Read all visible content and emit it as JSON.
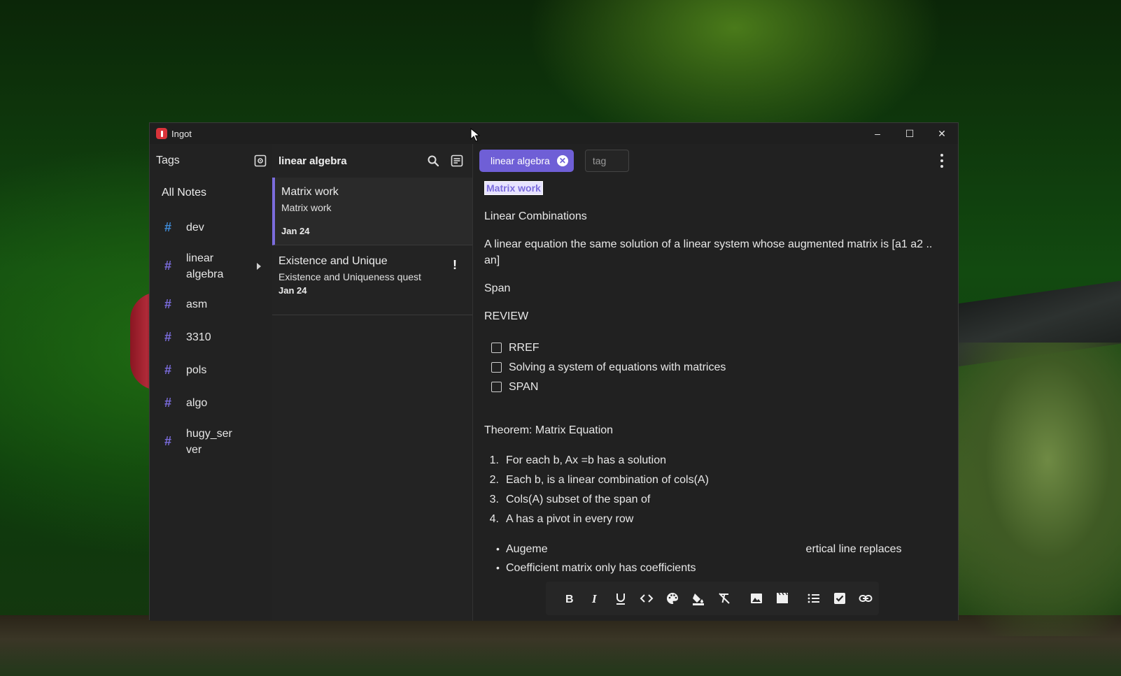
{
  "window": {
    "title": "Ingot",
    "controls": {
      "minimize": "–",
      "maximize": "☐",
      "close": "✕"
    }
  },
  "tags_panel": {
    "title": "Tags",
    "all_notes": "All Notes",
    "items": [
      {
        "label": "dev",
        "color": "#3f8bd8"
      },
      {
        "label": "linear algebra",
        "color": "#7b6cdc",
        "expandable": true
      },
      {
        "label": "asm",
        "color": "#7b6cdc"
      },
      {
        "label": "3310",
        "color": "#7b6cdc"
      },
      {
        "label": "pols",
        "color": "#7b6cdc"
      },
      {
        "label": "algo",
        "color": "#7b6cdc"
      },
      {
        "label": "hugy_server",
        "color": "#7b6cdc"
      }
    ]
  },
  "notes_panel": {
    "title": "linear algebra",
    "notes": [
      {
        "title": "Matrix work",
        "preview": "Matrix work",
        "date": "Jan 24",
        "active": true
      },
      {
        "title": "Existence and Unique",
        "preview": "Existence and Uniqueness quest",
        "date": "Jan 24",
        "flagged": true
      }
    ]
  },
  "editor": {
    "tag_chip": "linear algebra",
    "tag_input_placeholder": "tag",
    "heading": "Matrix work",
    "paragraphs": {
      "p1": "Linear Combinations",
      "p2": "A linear equation the same solution of a linear system whose augmented matrix is [a1 a2 .. an]",
      "p3": "Span",
      "p4": "REVIEW",
      "p5": "Theorem: Matrix Equation"
    },
    "checklist": [
      {
        "label": "RREF",
        "checked": false
      },
      {
        "label": "Solving a system of equations with matrices",
        "checked": false
      },
      {
        "label": "SPAN",
        "checked": false
      }
    ],
    "ordered_list": [
      {
        "num": "1.",
        "text": "For each b, Ax =b has a solution"
      },
      {
        "num": "2.",
        "text": "Each b, is a linear combination of cols(A)"
      },
      {
        "num": "3.",
        "text": "Cols(A) subset of the span of"
      },
      {
        "num": "4.",
        "text": "A has a pivot in every row"
      }
    ],
    "bullets": [
      {
        "text": "Augeme                                                                                   ertical line replaces"
      },
      {
        "text": "Coefficient matrix only has coefficients"
      }
    ],
    "toolbar": [
      "bold",
      "italic",
      "underline",
      "code",
      "text-color",
      "highlight",
      "clear-format",
      "image",
      "video",
      "bullet-list",
      "checklist",
      "link"
    ]
  },
  "colors": {
    "accent": "#7b6cdc",
    "window_bg": "#202020"
  }
}
